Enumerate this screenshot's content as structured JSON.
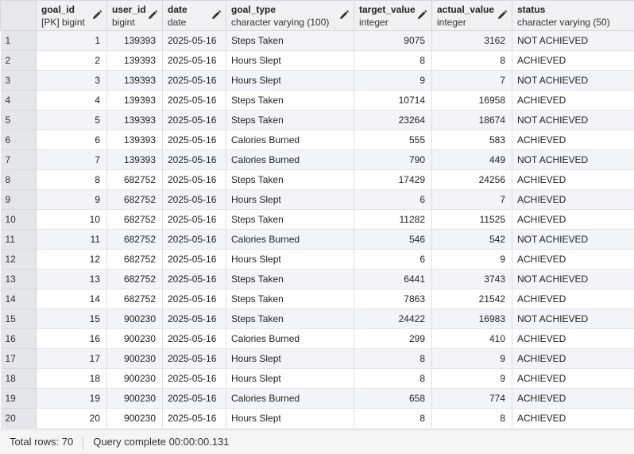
{
  "columns": [
    {
      "name": "goal_id",
      "type": "[PK] bigint"
    },
    {
      "name": "user_id",
      "type": "bigint"
    },
    {
      "name": "date",
      "type": "date"
    },
    {
      "name": "goal_type",
      "type": "character varying (100)"
    },
    {
      "name": "target_value",
      "type": "integer"
    },
    {
      "name": "actual_value",
      "type": "integer"
    },
    {
      "name": "status",
      "type": "character varying (50)"
    }
  ],
  "rows": [
    {
      "rn": "1",
      "goal_id": "1",
      "user_id": "139393",
      "date": "2025-05-16",
      "goal_type": "Steps Taken",
      "target": "9075",
      "actual": "3162",
      "status": "NOT ACHIEVED"
    },
    {
      "rn": "2",
      "goal_id": "2",
      "user_id": "139393",
      "date": "2025-05-16",
      "goal_type": "Hours Slept",
      "target": "8",
      "actual": "8",
      "status": "ACHIEVED"
    },
    {
      "rn": "3",
      "goal_id": "3",
      "user_id": "139393",
      "date": "2025-05-16",
      "goal_type": "Hours Slept",
      "target": "9",
      "actual": "7",
      "status": "NOT ACHIEVED"
    },
    {
      "rn": "4",
      "goal_id": "4",
      "user_id": "139393",
      "date": "2025-05-16",
      "goal_type": "Steps Taken",
      "target": "10714",
      "actual": "16958",
      "status": "ACHIEVED"
    },
    {
      "rn": "5",
      "goal_id": "5",
      "user_id": "139393",
      "date": "2025-05-16",
      "goal_type": "Steps Taken",
      "target": "23264",
      "actual": "18674",
      "status": "NOT ACHIEVED"
    },
    {
      "rn": "6",
      "goal_id": "6",
      "user_id": "139393",
      "date": "2025-05-16",
      "goal_type": "Calories Burned",
      "target": "555",
      "actual": "583",
      "status": "ACHIEVED"
    },
    {
      "rn": "7",
      "goal_id": "7",
      "user_id": "139393",
      "date": "2025-05-16",
      "goal_type": "Calories Burned",
      "target": "790",
      "actual": "449",
      "status": "NOT ACHIEVED"
    },
    {
      "rn": "8",
      "goal_id": "8",
      "user_id": "682752",
      "date": "2025-05-16",
      "goal_type": "Steps Taken",
      "target": "17429",
      "actual": "24256",
      "status": "ACHIEVED"
    },
    {
      "rn": "9",
      "goal_id": "9",
      "user_id": "682752",
      "date": "2025-05-16",
      "goal_type": "Hours Slept",
      "target": "6",
      "actual": "7",
      "status": "ACHIEVED"
    },
    {
      "rn": "10",
      "goal_id": "10",
      "user_id": "682752",
      "date": "2025-05-16",
      "goal_type": "Steps Taken",
      "target": "11282",
      "actual": "11525",
      "status": "ACHIEVED"
    },
    {
      "rn": "11",
      "goal_id": "11",
      "user_id": "682752",
      "date": "2025-05-16",
      "goal_type": "Calories Burned",
      "target": "546",
      "actual": "542",
      "status": "NOT ACHIEVED"
    },
    {
      "rn": "12",
      "goal_id": "12",
      "user_id": "682752",
      "date": "2025-05-16",
      "goal_type": "Hours Slept",
      "target": "6",
      "actual": "9",
      "status": "ACHIEVED"
    },
    {
      "rn": "13",
      "goal_id": "13",
      "user_id": "682752",
      "date": "2025-05-16",
      "goal_type": "Steps Taken",
      "target": "6441",
      "actual": "3743",
      "status": "NOT ACHIEVED"
    },
    {
      "rn": "14",
      "goal_id": "14",
      "user_id": "682752",
      "date": "2025-05-16",
      "goal_type": "Steps Taken",
      "target": "7863",
      "actual": "21542",
      "status": "ACHIEVED"
    },
    {
      "rn": "15",
      "goal_id": "15",
      "user_id": "900230",
      "date": "2025-05-16",
      "goal_type": "Steps Taken",
      "target": "24422",
      "actual": "16983",
      "status": "NOT ACHIEVED"
    },
    {
      "rn": "16",
      "goal_id": "16",
      "user_id": "900230",
      "date": "2025-05-16",
      "goal_type": "Calories Burned",
      "target": "299",
      "actual": "410",
      "status": "ACHIEVED"
    },
    {
      "rn": "17",
      "goal_id": "17",
      "user_id": "900230",
      "date": "2025-05-16",
      "goal_type": "Hours Slept",
      "target": "8",
      "actual": "9",
      "status": "ACHIEVED"
    },
    {
      "rn": "18",
      "goal_id": "18",
      "user_id": "900230",
      "date": "2025-05-16",
      "goal_type": "Hours Slept",
      "target": "8",
      "actual": "9",
      "status": "ACHIEVED"
    },
    {
      "rn": "19",
      "goal_id": "19",
      "user_id": "900230",
      "date": "2025-05-16",
      "goal_type": "Calories Burned",
      "target": "658",
      "actual": "774",
      "status": "ACHIEVED"
    },
    {
      "rn": "20",
      "goal_id": "20",
      "user_id": "900230",
      "date": "2025-05-16",
      "goal_type": "Hours Slept",
      "target": "8",
      "actual": "8",
      "status": "ACHIEVED"
    }
  ],
  "statusbar": {
    "total_rows": "Total rows: 70",
    "query": "Query complete 00:00:00.131"
  },
  "icons": {
    "column_edit": "pencil-icon"
  },
  "colors": {
    "header_bg": "#f0f1f3",
    "odd_row_bg": "#f2f4f7",
    "row_number_bg": "#e3e6ea"
  }
}
